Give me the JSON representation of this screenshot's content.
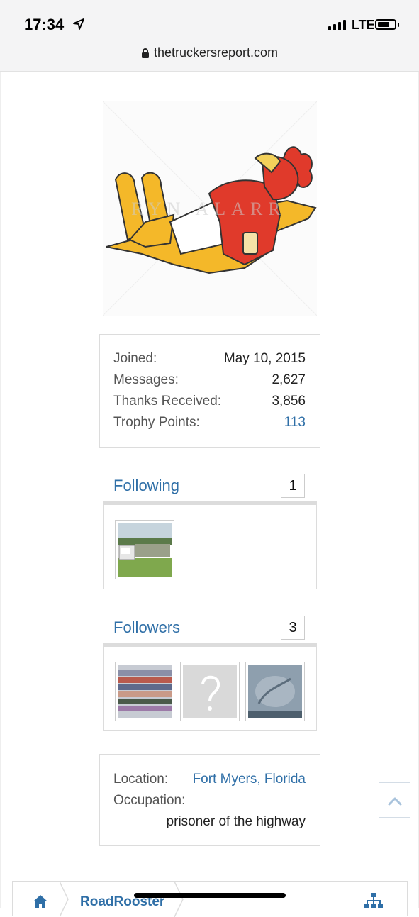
{
  "statusbar": {
    "time": "17:34",
    "network": "LTE"
  },
  "browser": {
    "url": "thetruckersreport.com"
  },
  "profile": {
    "avatar_watermark": "RYN ALARR"
  },
  "stats": [
    {
      "label": "Joined:",
      "value": "May 10, 2015"
    },
    {
      "label": "Messages:",
      "value": "2,627"
    },
    {
      "label": "Thanks Received:",
      "value": "3,856"
    },
    {
      "label": "Trophy Points:",
      "value": "113"
    }
  ],
  "following": {
    "title": "Following",
    "count": "1"
  },
  "followers": {
    "title": "Followers",
    "count": "3"
  },
  "info": {
    "location_label": "Location:",
    "location_value": "Fort Myers, Florida",
    "occupation_label": "Occupation:",
    "occupation_value": "prisoner of the highway"
  },
  "breadcrumb": {
    "username": "RoadRooster"
  },
  "colors": {
    "link": "#2f6fa7",
    "border": "#dcdcdc"
  },
  "icons": [
    "location-arrow-icon",
    "signal-icon",
    "battery-icon",
    "lock-icon",
    "chevron-up-icon",
    "home-icon",
    "sitemap-icon"
  ]
}
